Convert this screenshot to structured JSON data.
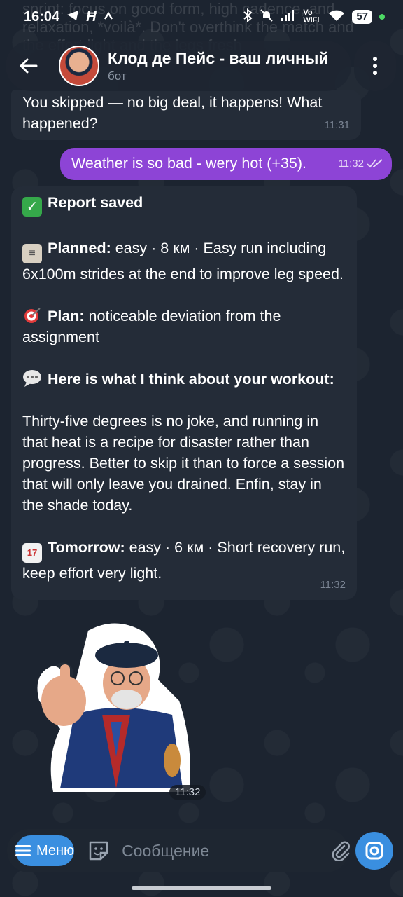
{
  "status_bar": {
    "time": "16:04",
    "left_icons": [
      "telegram-icon",
      "h-icon",
      "caret-icon"
    ],
    "right_icons": [
      "bluetooth-icon",
      "mute-icon",
      "signal-icon",
      "vowifi-icon",
      "wifi-icon"
    ],
    "vowifi_label": "Vo WiFi",
    "battery": "57"
  },
  "ghost_text": "sprint: focus on good form, high cadence, and relaxation, *voilà*. Don't overthink the match and the effort light and the legs fresh",
  "header": {
    "title": "Клод де Пейс - ваш личный",
    "subtitle": "бот"
  },
  "messages": [
    {
      "text": "You skipped — no big deal, it happens! What happened?",
      "time": "11:31"
    },
    {
      "text": "Weather is so bad - wery hot (+35).",
      "time": "11:32",
      "read": true
    },
    {
      "time": "11:32",
      "report_title": "Report saved",
      "planned_label": "Planned:",
      "planned_text": " easy · 8 км · Easy run including 6x100m strides at the end to improve leg speed.",
      "plan_label": "Plan:",
      "plan_text": " noticeable deviation from the assignment",
      "opinion_label": "Here is what I think about your workout:",
      "opinion_text": "Thirty-five degrees is no joke, and running in that heat is a recipe for disaster rather than progress. Better to skip it than to force a session that will only leave you drained. Enfin, stay in the shade today.",
      "tomorrow_label": "Tomorrow:",
      "tomorrow_text": " easy · 6 км · Short recovery run, keep effort very light.",
      "calendar_day": "17"
    }
  ],
  "sticker": {
    "time": "11:32"
  },
  "input": {
    "menu_label": "Меню",
    "placeholder": "Сообщение"
  },
  "colors": {
    "background": "#1c2430",
    "incoming_bubble": "#242c38",
    "outgoing_bubble": "#8d44d6",
    "accent": "#3a8fe0"
  }
}
